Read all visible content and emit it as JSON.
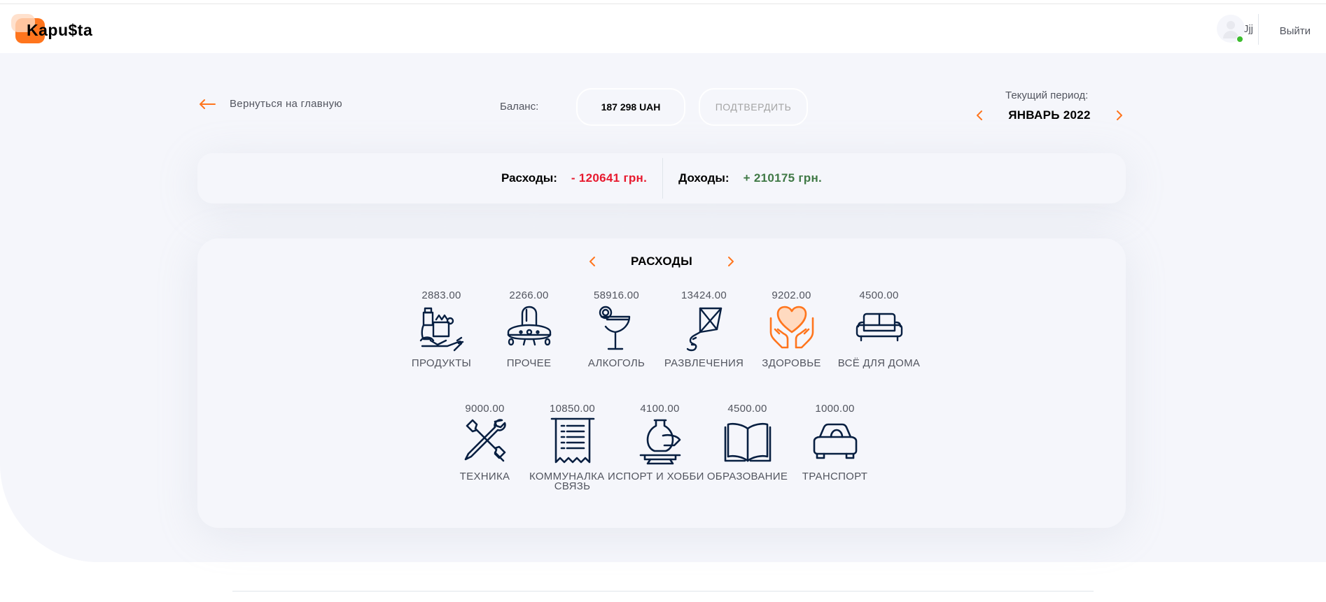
{
  "app": {
    "logo": "Kapu$ta"
  },
  "user": {
    "name": "Jjj",
    "logout": "Выйти"
  },
  "toolbar": {
    "back_label": "Вернуться на главную",
    "balance_label": "Баланс:",
    "balance_value": "187 298 UAH",
    "confirm_label": "ПОДТВЕРДИТЬ",
    "period_label": "Текущий период:",
    "period_value": "ЯНВАРЬ 2022"
  },
  "summary": {
    "expense_label": "Расходы:",
    "expense_value": "- 120641 грн.",
    "income_label": "Доходы:",
    "income_value": "+ 210175 грн."
  },
  "categories": {
    "title": "РАСХОДЫ",
    "items": [
      {
        "amount": "2883.00",
        "name": "ПРОДУКТЫ",
        "icon": "groceries-icon"
      },
      {
        "amount": "2266.00",
        "name": "ПРОЧЕЕ",
        "icon": "ufo-icon"
      },
      {
        "amount": "58916.00",
        "name": "АЛКОГОЛЬ",
        "icon": "cocktail-icon"
      },
      {
        "amount": "13424.00",
        "name": "РАЗВЛЕЧЕНИЯ",
        "icon": "kite-icon"
      },
      {
        "amount": "9202.00",
        "name": "ЗДОРОВЬЕ",
        "icon": "heart-hands-icon"
      },
      {
        "amount": "4500.00",
        "name": "ВСЁ ДЛЯ ДОМА",
        "icon": "sofa-icon"
      },
      {
        "amount": "9000.00",
        "name": "ТЕХНИКА",
        "icon": "tools-icon"
      },
      {
        "amount": "10850.00",
        "name": "КОММУНАЛКА И СВЯЗЬ",
        "icon": "receipt-icon"
      },
      {
        "amount": "4100.00",
        "name": "СПОРТ И ХОББИ",
        "icon": "pottery-icon"
      },
      {
        "amount": "4500.00",
        "name": "ОБРАЗОВАНИЕ",
        "icon": "book-icon"
      },
      {
        "amount": "1000.00",
        "name": "ТРАНСПОРТ",
        "icon": "car-icon"
      }
    ],
    "active_index": 4
  },
  "colors": {
    "accent": "#ff751d",
    "expense": "#e7192e",
    "income": "#407946",
    "icon_dark": "#071F41",
    "background": "#f5f6fb"
  }
}
